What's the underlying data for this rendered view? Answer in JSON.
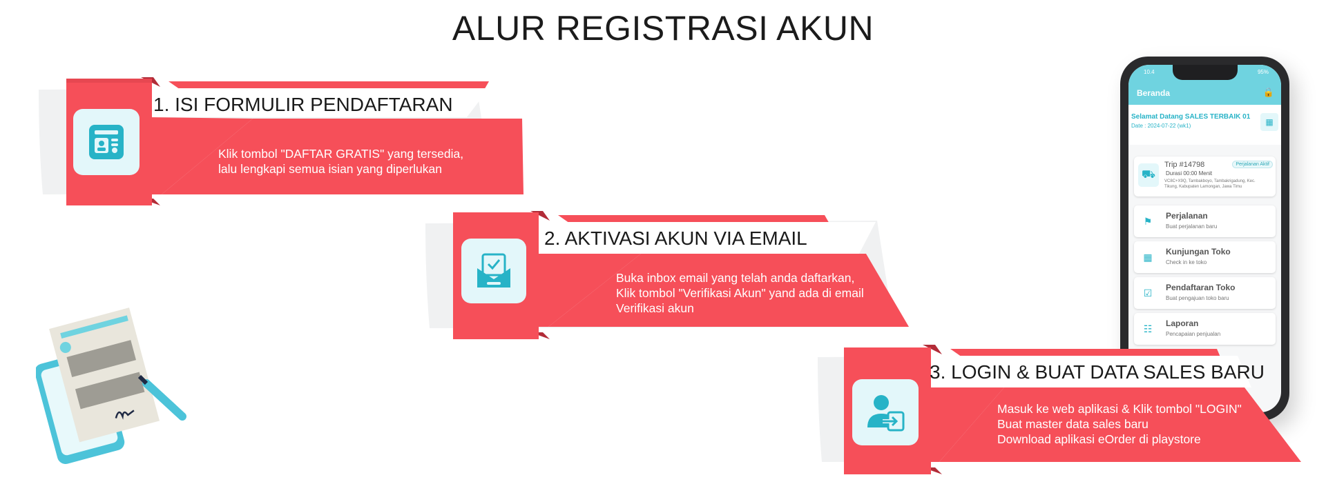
{
  "title": "ALUR REGISTRASI AKUN",
  "colors": {
    "accent": "#f64f59",
    "accent_dark": "#c83542",
    "icon_teal": "#27b3c7",
    "icon_bg": "#e3f7fa"
  },
  "steps": [
    {
      "heading": "1. ISI FORMULIR PENDAFTARAN",
      "icon": "form-icon",
      "lines": [
        "Klik tombol \"DAFTAR GRATIS\" yang tersedia,",
        "lalu lengkapi semua isian yang diperlukan"
      ]
    },
    {
      "heading": "2. AKTIVASI AKUN VIA EMAIL",
      "icon": "email-check-icon",
      "lines": [
        "Buka inbox email yang telah anda daftarkan,",
        "Klik tombol \"Verifikasi Akun\" yand ada di email",
        "Verifikasi akun"
      ]
    },
    {
      "heading": "3. LOGIN & BUAT DATA SALES BARU",
      "icon": "user-login-icon",
      "lines": [
        "Masuk ke web aplikasi & Klik tombol \"LOGIN\"",
        "Buat master data sales baru",
        "Download aplikasi eOrder di playstore"
      ]
    }
  ],
  "phone": {
    "status_time": "10.4",
    "status_battery": "95%",
    "appbar_title": "Beranda",
    "welcome": "Selamat Datang SALES TERBAIK 01",
    "date": "Date : 2024-07-22 (wk1)",
    "trip": {
      "number": "Trip #14798",
      "badge": "Perjalanan Aktif",
      "duration": "Durasi 00:00 Menit",
      "address": "VC8C+X9Q, Tambakboyo, Tambakrigadung, Kec. Tikung, Kabupaten Lamongan, Jawa Timu"
    },
    "menu": [
      {
        "label": "Perjalanan",
        "sub": "Buat perjalanan baru",
        "icon": "route-icon"
      },
      {
        "label": "Kunjungan Toko",
        "sub": "Check in ke toko",
        "icon": "store-icon"
      },
      {
        "label": "Pendaftaran Toko",
        "sub": "Buat pengajuan toko baru",
        "icon": "clipboard-icon"
      },
      {
        "label": "Laporan",
        "sub": "Pencapaian penjualan",
        "icon": "report-icon"
      }
    ]
  }
}
